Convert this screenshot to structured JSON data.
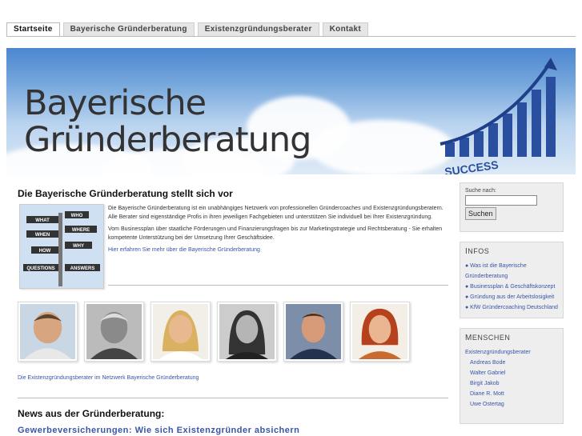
{
  "nav": {
    "tabs": [
      "Startseite",
      "Bayerische Gründerberatung",
      "Existenzgründungsberater",
      "Kontakt"
    ],
    "active": 0
  },
  "banner": {
    "line1": "Bayerische",
    "line2": "Gründerberatung",
    "success_word": "SUCCESS"
  },
  "thumb_signs": [
    "WHAT",
    "WHO",
    "WHEN",
    "WHERE",
    "HOW",
    "WHY",
    "QUESTIONS",
    "ANSWERS"
  ],
  "main": {
    "heading": "Die Bayerische Gründerberatung stellt sich vor",
    "p1": "Die Bayerische Gründerberatung ist ein unabhängiges Netzwerk von professionellen Gründercoaches und Existenzgründungsberatern. Alle Berater sind eigenständige Profis in ihren jeweiligen Fachgebieten und unterstützen Sie individuell bei Ihrer Existenzgründung.",
    "p2": "Vom Businessplan über staatliche Förderungen und Finanzierungsfragen bis zur Marketingstrategie und Rechtsberatung - Sie erhalten kompetente Unterstützung bei der Umsetzung Ihrer Geschäftsidee.",
    "more_link": "Hier erfahren Sie mehr über die Bayerische Gründerberatung",
    "team_link": "Die Existenzgründungsberater im Netzwerk Bayerische Gründerberatung",
    "news_heading": "News aus der Gründerberatung:",
    "news_item": "Gewerbeversicherungen: Wie sich Existenzgründer absichern"
  },
  "sidebar": {
    "search_label": "Suche nach:",
    "search_value": "",
    "search_button": "Suchen",
    "infos_title_first": "I",
    "infos_title_rest": "NFOS",
    "infos": [
      "● Was ist die Bayerische Gründerberatung",
      "● Businessplan & Geschäftskonzept",
      "● Gründung aus der Arbeitslosigkeit",
      "● KfW Gründercoaching Deutschland"
    ],
    "menschen_title_first": "M",
    "menschen_title_rest": "ENSCHEN",
    "menschen_head": "Existenzgründungsberater",
    "menschen": [
      "Andreas Bode",
      "Walter Gabriel",
      "Birgit Jakob",
      "Diane R. Mott",
      "Uwe Ostertag"
    ]
  },
  "colors": {
    "link": "#3a55a8",
    "bars": "#2a4f9e",
    "arrow": "#1f3f8a"
  }
}
